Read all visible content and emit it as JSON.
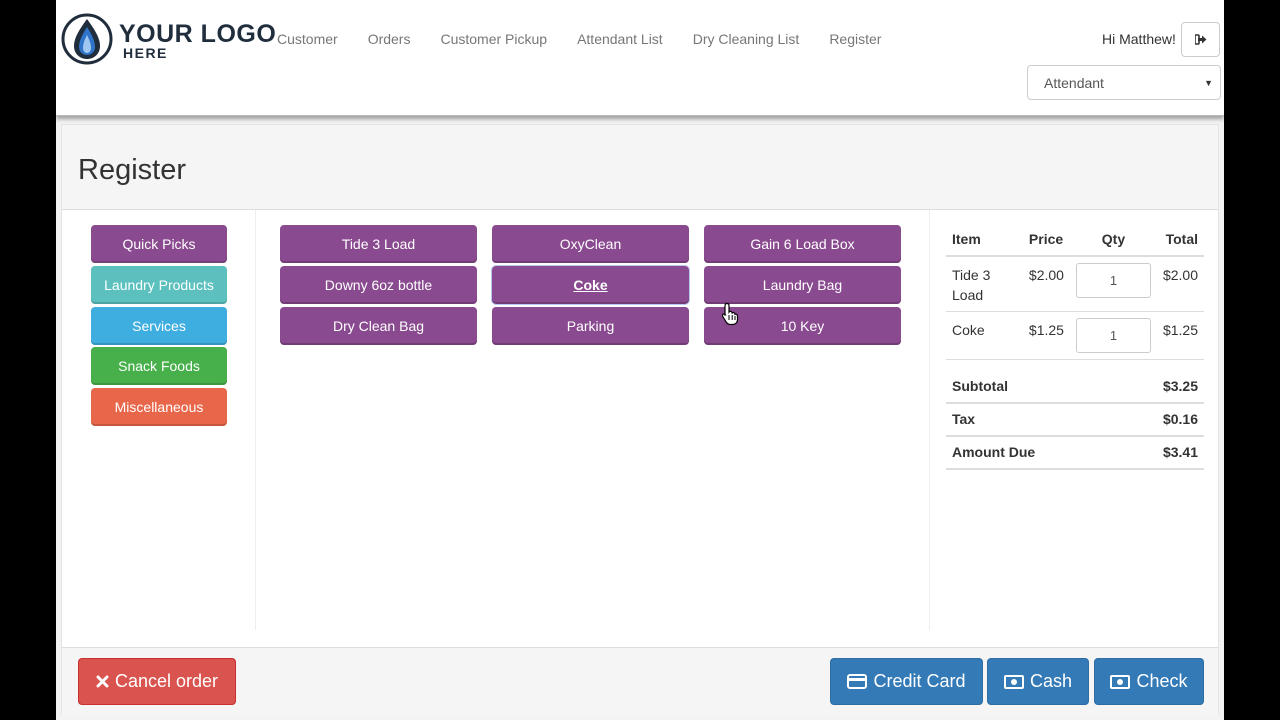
{
  "logo": {
    "line1": "YOUR LOGO",
    "line2": "HERE"
  },
  "nav": [
    "Customer",
    "Orders",
    "Customer Pickup",
    "Attendant List",
    "Dry Cleaning List",
    "Register"
  ],
  "user": {
    "greeting": "Hi Matthew!",
    "role": "Attendant"
  },
  "page": {
    "title": "Register"
  },
  "categories": [
    {
      "label": "Quick Picks",
      "color": "#8a4a8f"
    },
    {
      "label": "Laundry Products",
      "color": "#5bc0be"
    },
    {
      "label": "Services",
      "color": "#3eaee0"
    },
    {
      "label": "Snack Foods",
      "color": "#47b04b"
    },
    {
      "label": "Miscellaneous",
      "color": "#e8664a"
    }
  ],
  "products": [
    "Tide 3 Load",
    "OxyClean",
    "Gain 6 Load Box",
    "Downy 6oz bottle",
    "Coke",
    "Laundry Bag",
    "Dry Clean Bag",
    "Parking",
    "10 Key"
  ],
  "product_color": "#8a4a8f",
  "order": {
    "headers": [
      "Item",
      "Price",
      "Qty",
      "Total"
    ],
    "items": [
      {
        "name": "Tide 3 Load",
        "price": "$2.00",
        "qty": "1",
        "total": "$2.00"
      },
      {
        "name": "Coke",
        "price": "$1.25",
        "qty": "1",
        "total": "$1.25"
      }
    ],
    "subtotal_label": "Subtotal",
    "subtotal": "$3.25",
    "tax_label": "Tax",
    "tax": "$0.16",
    "due_label": "Amount Due",
    "due": "$3.41"
  },
  "footer": {
    "cancel": "Cancel order",
    "credit": "Credit Card",
    "cash": "Cash",
    "check": "Check"
  }
}
